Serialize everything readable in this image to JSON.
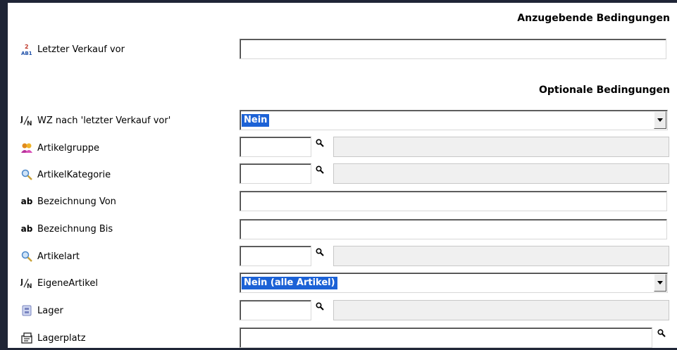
{
  "headers": {
    "required": "Anzugebende Bedingungen",
    "optional": "Optionale Bedingungen"
  },
  "fields": {
    "last_sale": {
      "label": "Letzter Verkauf vor",
      "value": "",
      "icon": "sort-numbers-icon"
    },
    "wz_after": {
      "label": "WZ nach 'letzter Verkauf vor'",
      "value": "Nein",
      "icon": "yes-no-icon"
    },
    "article_group": {
      "label": "Artikelgruppe",
      "code": "",
      "description": "",
      "icon": "group-icon"
    },
    "article_category": {
      "label": "ArtikelKategorie",
      "code": "",
      "description": "",
      "icon": "magnifier-icon"
    },
    "name_from": {
      "label": "Bezeichnung Von",
      "value": "",
      "icon": "text-ab-icon"
    },
    "name_to": {
      "label": "Bezeichnung Bis",
      "value": "",
      "icon": "text-ab-icon"
    },
    "article_type": {
      "label": "Artikelart",
      "code": "",
      "description": "",
      "icon": "magnifier-icon"
    },
    "own_articles": {
      "label": "EigeneArtikel",
      "value": "Nein (alle Artikel)",
      "icon": "yes-no-icon"
    },
    "warehouse": {
      "label": "Lager",
      "code": "",
      "description": "",
      "icon": "warehouse-icon"
    },
    "storage_location": {
      "label": "Lagerplatz",
      "value": "",
      "icon": "storage-location-icon"
    }
  }
}
